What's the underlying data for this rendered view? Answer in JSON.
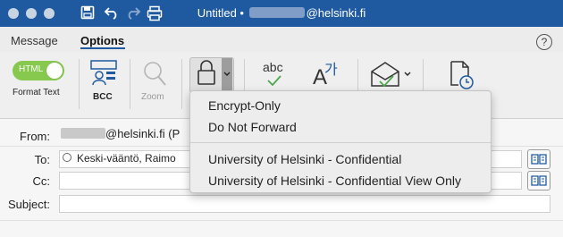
{
  "window": {
    "title_prefix": "Untitled •",
    "title_suffix": "@helsinki.fi"
  },
  "ribbon": {
    "tabs": [
      {
        "label": "Message",
        "active": false
      },
      {
        "label": "Options",
        "active": true
      }
    ],
    "toggle_text": "HTML",
    "format_text_label": "Format Text",
    "bcc_label": "BCC",
    "zoom_label": "Zoom",
    "encrypt_icon": "lock-icon",
    "spelling_glyph": "abc",
    "translate_glyph": "가",
    "read_receipt_icon": "envelope-check-icon",
    "delay_icon": "clock-document-icon",
    "toggle_color": "#86c94e",
    "accent": "#1f5aa0"
  },
  "form": {
    "from_label": "From:",
    "from_value": "@helsinki.fi (P",
    "to_label": "To:",
    "to_recipient": "Keski-vääntö, Raimo",
    "cc_label": "Cc:",
    "subject_label": "Subject:"
  },
  "encrypt_menu": {
    "items": [
      "Encrypt-Only",
      "Do Not Forward",
      "University of Helsinki - Confidential",
      "University of Helsinki - Confidential View Only"
    ]
  }
}
